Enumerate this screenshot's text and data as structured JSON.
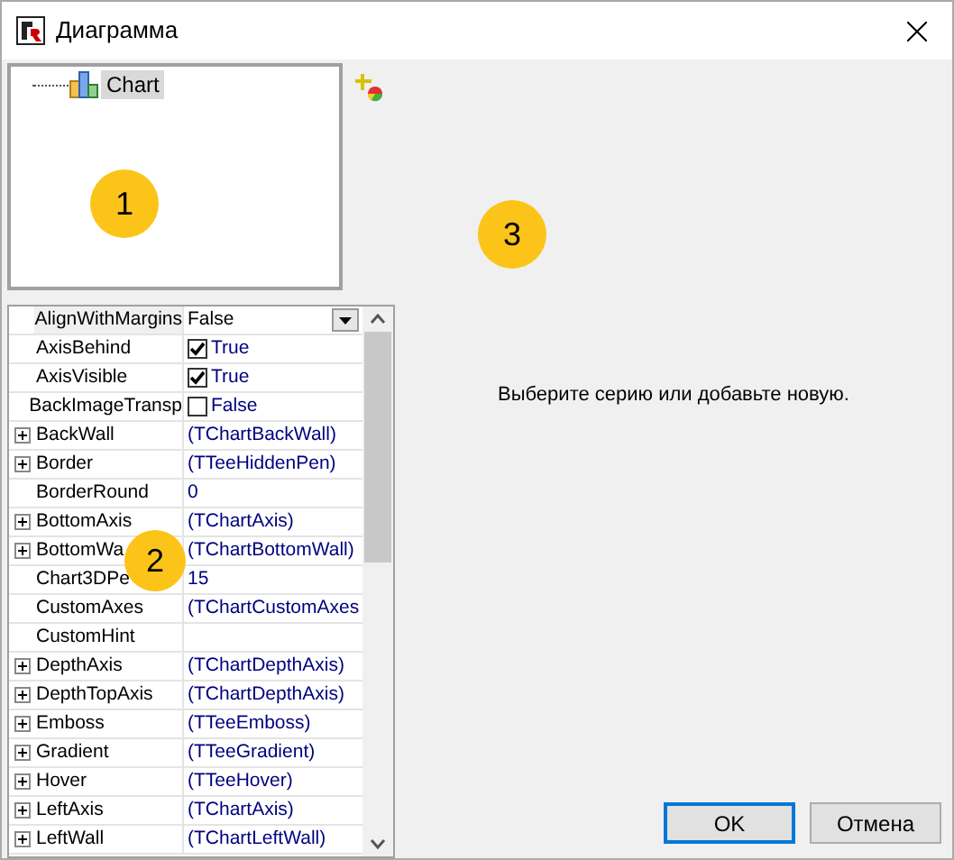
{
  "window": {
    "title": "Диаграмма"
  },
  "tree": {
    "items": [
      {
        "label": "Chart",
        "selected": true
      }
    ]
  },
  "properties": [
    {
      "name": "AlignWithMargins",
      "value": "False",
      "kind": "dropdown",
      "expandable": false,
      "selected": true
    },
    {
      "name": "AxisBehind",
      "value": "True",
      "kind": "check",
      "checked": true,
      "expandable": false,
      "selected": false
    },
    {
      "name": "AxisVisible",
      "value": "True",
      "kind": "check",
      "checked": true,
      "expandable": false,
      "selected": false
    },
    {
      "name": "BackImageTransp",
      "value": "False",
      "kind": "check",
      "checked": false,
      "expandable": false,
      "selected": false
    },
    {
      "name": "BackWall",
      "value": "(TChartBackWall)",
      "kind": "object",
      "expandable": true,
      "selected": false
    },
    {
      "name": "Border",
      "value": "(TTeeHiddenPen)",
      "kind": "object",
      "expandable": true,
      "selected": false
    },
    {
      "name": "BorderRound",
      "value": "0",
      "kind": "text",
      "expandable": false,
      "selected": false
    },
    {
      "name": "BottomAxis",
      "value": "(TChartAxis)",
      "kind": "object",
      "expandable": true,
      "selected": false
    },
    {
      "name": "BottomWa",
      "value": "(TChartBottomWall)",
      "kind": "object",
      "expandable": true,
      "selected": false
    },
    {
      "name": "Chart3DPe",
      "value": "15",
      "kind": "text",
      "expandable": false,
      "selected": false
    },
    {
      "name": "CustomAxes",
      "value": "(TChartCustomAxes",
      "kind": "object",
      "expandable": false,
      "selected": false
    },
    {
      "name": "CustomHint",
      "kind": "text",
      "expandable": false,
      "selected": false
    },
    {
      "name": "DepthAxis",
      "value": "(TChartDepthAxis)",
      "kind": "object",
      "expandable": true,
      "selected": false
    },
    {
      "name": "DepthTopAxis",
      "value": "(TChartDepthAxis)",
      "kind": "object",
      "expandable": true,
      "selected": false
    },
    {
      "name": "Emboss",
      "value": "(TTeeEmboss)",
      "kind": "object",
      "expandable": true,
      "selected": false
    },
    {
      "name": "Gradient",
      "value": "(TTeeGradient)",
      "kind": "object",
      "expandable": true,
      "selected": false
    },
    {
      "name": "Hover",
      "value": "(TTeeHover)",
      "kind": "object",
      "expandable": true,
      "selected": false
    },
    {
      "name": "LeftAxis",
      "value": "(TChartAxis)",
      "kind": "object",
      "expandable": true,
      "selected": false
    },
    {
      "name": "LeftWall",
      "value": "(TChartLeftWall)",
      "kind": "object",
      "expandable": true,
      "selected": false
    }
  ],
  "message": "Выберите серию или добавьте новую.",
  "markers": [
    "1",
    "2",
    "3"
  ],
  "buttons": [
    {
      "label": "OK",
      "default": true
    },
    {
      "label": "Отмена",
      "default": false
    }
  ]
}
